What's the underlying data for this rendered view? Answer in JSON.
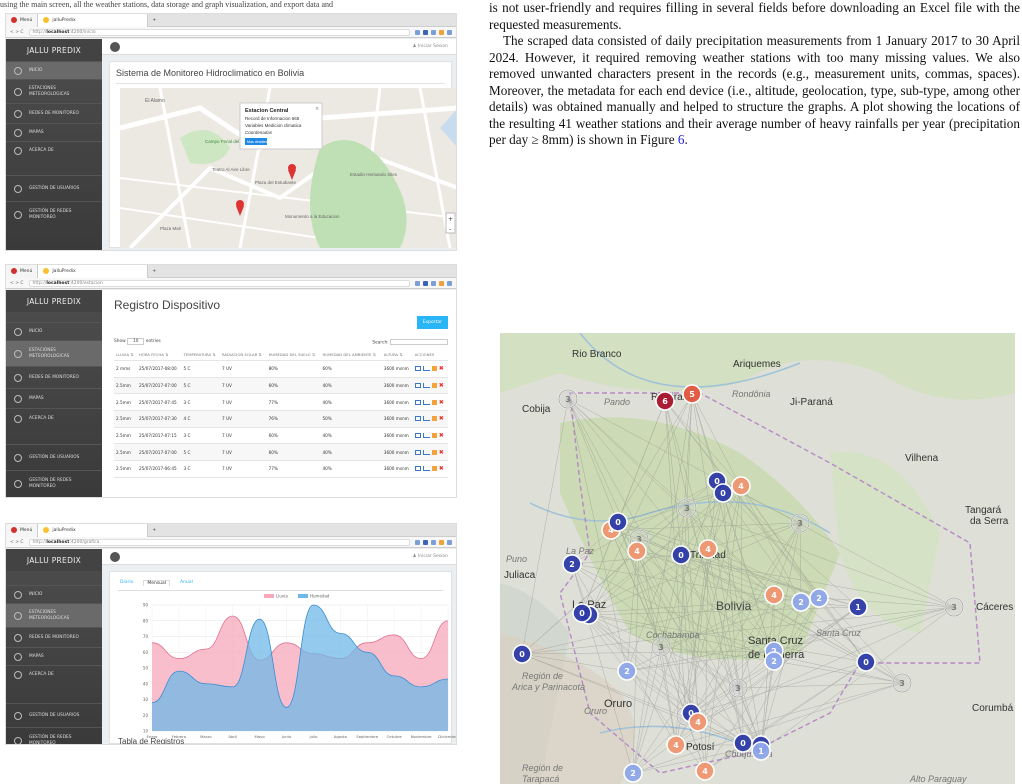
{
  "top_caption": "using the main screen, all the weather stations, data storage and graph visualization, and export data and",
  "body": {
    "p1": "is not user-friendly and requires filling in several fields before downloading an Excel file with the requested measurements.",
    "p2": "The scraped data consisted of daily precipitation measurements from 1 January 2017 to 30 April 2024. However, it required removing weather stations with too many missing values. We also removed unwanted characters present in the records (e.g., measurement units, commas, spaces). Moreover, the metadata for each end device (i.e., altitude, geolocation, type, sub-type, among other details) was obtained manually and helped to structure the graphs. A plot showing the locations of the resulting 41 weather stations and their average number of heavy rainfalls per year (precipitation per day ≥ 8mm) is shown in Figure ",
    "fig_ref": "6",
    "p2_end": "."
  },
  "browser": {
    "tab1": "Menú",
    "tab2": "JalluPredix",
    "tab2_b": "jalluPredix",
    "url_prefix": "http://",
    "url_host": "localhost",
    "url_path1": ":4200/inicio",
    "url_path2": ":4200/estacion",
    "url_path3": ":4200/grafica"
  },
  "sidebar": {
    "brand": "JALLU PREDIX",
    "items": [
      "INICIO",
      "ESTACIONES METEOROLOGICAS",
      "REDES DE MONITOREO",
      "MAPAS",
      "ACERCA DE",
      "GESTIÓN DE USUARIOS",
      "GESTIÓN DE REDES MONITOREO"
    ]
  },
  "topbar": {
    "login": "Iniciar Sesion"
  },
  "shot1": {
    "title": "Sistema de Monitoreo Hidroclimatico en Bolivia",
    "popup_title": "Estacion Central",
    "popup_l1": "Record de Informacion 665",
    "popup_l2": "Variables Medicion climatica",
    "popup_l3": "Coordenadas",
    "popup_btn": "Mas detalles",
    "streets": [
      "El Alamo",
      "Campo Ferial del Bicentenario",
      "Teatro Al Aire Libre",
      "Plaza del Estudiante",
      "Estadio Hernando Siles",
      "Monumento a la Educacion",
      "Plaza Mari"
    ]
  },
  "shot2": {
    "title": "Registro Dispositivo",
    "export": "Exportar",
    "show": "Show",
    "show_n": "10",
    "entries": "entries",
    "search": "Search:",
    "headers": [
      "LLUVIA",
      "HORA FECHA",
      "TEMPERATURA",
      "RADIACION SOLAR",
      "HUMEDAD DEL SUELO",
      "HUMEDAD DEL AMBIENTE",
      "ALTURA",
      "ACCIONES"
    ],
    "rows": [
      [
        "2 mms",
        "25/07/2017-08:00",
        "5 C",
        "7 UV",
        "80%",
        "60%",
        "3600 msnm"
      ],
      [
        "2.5mm",
        "25/07/2017-07:00",
        "5 C",
        "7 UV",
        "60%",
        "40%",
        "3600 msnm"
      ],
      [
        "2.5mm",
        "25/07/2017-07:45",
        "3 C",
        "7 UV",
        "77%",
        "40%",
        "3600 msnm"
      ],
      [
        "2.5mm",
        "25/07/2017-07:30",
        "4 C",
        "7 UV",
        "76%",
        "50%",
        "3600 msnm"
      ],
      [
        "2.5mm",
        "25/07/2017-07:15",
        "3 C",
        "7 UV",
        "60%",
        "40%",
        "3600 msnm"
      ],
      [
        "2.5mm",
        "25/07/2017-07:00",
        "5 C",
        "7 UV",
        "60%",
        "40%",
        "3600 msnm"
      ],
      [
        "2.5mm",
        "25/07/2017-06:45",
        "3 C",
        "7 UV",
        "77%",
        "40%",
        "3600 msnm"
      ]
    ]
  },
  "shot3": {
    "tabs": [
      "Diario",
      "Mensual",
      "Anual"
    ],
    "legend": [
      "Lluvia",
      "Humedad"
    ],
    "footer": "Tabla de Registros"
  },
  "chart_data": {
    "type": "area",
    "categories": [
      "Enero",
      "Febrero",
      "Marzo",
      "Abril",
      "Mayo",
      "Junio",
      "Julio",
      "Agosto",
      "Septiembre",
      "Octubre",
      "Noviembre",
      "Diciembre"
    ],
    "series": [
      {
        "name": "Lluvia",
        "values": [
          66,
          56,
          62,
          83,
          55,
          66,
          59,
          56,
          66,
          71,
          56,
          80
        ],
        "color": "#f7a8bb"
      },
      {
        "name": "Humedad",
        "values": [
          28,
          48,
          40,
          38,
          81,
          25,
          90,
          72,
          60,
          45,
          38,
          43
        ],
        "color": "#6fb8e8"
      }
    ],
    "yticks": [
      10,
      20,
      30,
      40,
      50,
      60,
      70,
      80,
      90
    ],
    "ylim": [
      10,
      90
    ]
  },
  "map": {
    "places": [
      {
        "t": "Rio Branco",
        "c": "#333",
        "s": 10
      },
      {
        "t": "Ariquemes",
        "c": "#333",
        "s": 10
      },
      {
        "t": "Ribeiralta",
        "c": "#333",
        "s": 10
      },
      {
        "t": "Cobija",
        "c": "#333",
        "s": 10
      },
      {
        "t": "Pando",
        "c": "#777",
        "s": 9,
        "i": true
      },
      {
        "t": "Rondônia",
        "c": "#777",
        "s": 9,
        "i": true
      },
      {
        "t": "Ji-Paraná",
        "c": "#333",
        "s": 10
      },
      {
        "t": "Vilhena",
        "c": "#333",
        "s": 10
      },
      {
        "t": "Tangará",
        "c": "#333",
        "s": 10
      },
      {
        "t": "da Serra",
        "c": "#333",
        "s": 10
      },
      {
        "t": "Puno",
        "c": "#777",
        "s": 9,
        "i": true
      },
      {
        "t": "La Paz",
        "c": "#777",
        "s": 9,
        "i": true
      },
      {
        "t": "Trinidad",
        "c": "#333",
        "s": 10
      },
      {
        "t": "Juliaca",
        "c": "#333",
        "s": 10
      },
      {
        "t": "La Paz",
        "c": "#333",
        "s": 11
      },
      {
        "t": "Bolivia",
        "c": "#444",
        "s": 12
      },
      {
        "t": "Cáceres",
        "c": "#333",
        "s": 10
      },
      {
        "t": "Cochabamba",
        "c": "#777",
        "s": 9,
        "i": true
      },
      {
        "t": "Santa Cruz",
        "c": "#333",
        "s": 11
      },
      {
        "t": "de la Sierra",
        "c": "#333",
        "s": 11
      },
      {
        "t": "Santa Cruz",
        "c": "#777",
        "s": 9,
        "i": true
      },
      {
        "t": "Región de",
        "c": "#777",
        "s": 9,
        "i": true
      },
      {
        "t": "Arica y Parinacota",
        "c": "#777",
        "s": 9,
        "i": true
      },
      {
        "t": "Oruro",
        "c": "#333",
        "s": 11
      },
      {
        "t": "Oruro",
        "c": "#777",
        "s": 9,
        "i": true
      },
      {
        "t": "Corumbá",
        "c": "#333",
        "s": 10
      },
      {
        "t": "Potosí",
        "c": "#333",
        "s": 10
      },
      {
        "t": "Chuquisaca",
        "c": "#777",
        "s": 9,
        "i": true
      },
      {
        "t": "Región de",
        "c": "#777",
        "s": 9,
        "i": true
      },
      {
        "t": "Tarapacá",
        "c": "#777",
        "s": 9,
        "i": true
      },
      {
        "t": "Alto Paraguay",
        "c": "#777",
        "s": 9,
        "i": true
      }
    ],
    "markers": [
      {
        "v": "6",
        "k": "dark"
      },
      {
        "v": "5",
        "k": "red"
      },
      {
        "v": "3",
        "k": "grey"
      },
      {
        "v": "0",
        "k": "blue"
      },
      {
        "v": "4",
        "k": "orange"
      },
      {
        "v": "0",
        "k": "blue"
      },
      {
        "v": "3",
        "k": "grey"
      },
      {
        "v": "4",
        "k": "orange"
      },
      {
        "v": "0",
        "k": "blue"
      },
      {
        "v": "3",
        "k": "grey"
      },
      {
        "v": "4",
        "k": "orange"
      },
      {
        "v": "0",
        "k": "blue"
      },
      {
        "v": "4",
        "k": "orange"
      },
      {
        "v": "2",
        "k": "blue"
      },
      {
        "v": "4",
        "k": "orange"
      },
      {
        "v": "2",
        "k": "light"
      },
      {
        "v": "2",
        "k": "light"
      },
      {
        "v": "1",
        "k": "blue"
      },
      {
        "v": "3",
        "k": "grey"
      },
      {
        "v": "0",
        "k": "blue"
      },
      {
        "v": "0",
        "k": "blue"
      },
      {
        "v": "3",
        "k": "grey"
      },
      {
        "v": "2",
        "k": "light"
      },
      {
        "v": "2",
        "k": "light"
      },
      {
        "v": "0",
        "k": "blue"
      },
      {
        "v": "3",
        "k": "grey"
      },
      {
        "v": "2",
        "k": "light"
      },
      {
        "v": "3",
        "k": "grey"
      },
      {
        "v": "3",
        "k": "grey"
      },
      {
        "v": "0",
        "k": "blue"
      },
      {
        "v": "4",
        "k": "orange"
      },
      {
        "v": "4",
        "k": "orange"
      },
      {
        "v": "0",
        "k": "blue"
      },
      {
        "v": "0",
        "k": "blue"
      },
      {
        "v": "1",
        "k": "light"
      },
      {
        "v": "2",
        "k": "light"
      },
      {
        "v": "4",
        "k": "orange"
      },
      {
        "v": "3",
        "k": "grey"
      },
      {
        "v": "0",
        "k": "blue"
      }
    ],
    "marker_colors": {
      "dark": "#a8142c",
      "red": "#e2573e",
      "orange": "#ef9670",
      "grey": "#d0d0d0",
      "blue": "#2b3aa8",
      "light": "#8ea6ea"
    }
  }
}
